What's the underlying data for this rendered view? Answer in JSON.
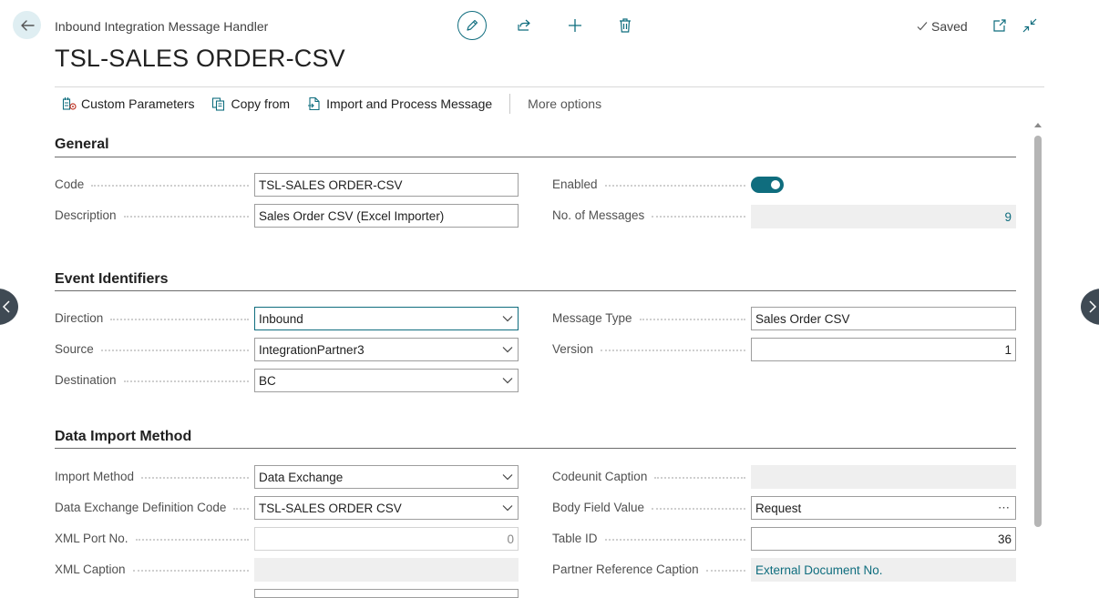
{
  "header": {
    "breadcrumb": "Inbound Integration Message Handler",
    "title": "TSL-SALES ORDER-CSV",
    "saved_label": "Saved"
  },
  "actions": {
    "custom_parameters": "Custom Parameters",
    "copy_from": "Copy from",
    "import_process": "Import and Process Message",
    "more_options": "More options"
  },
  "general": {
    "title": "General",
    "code_label": "Code",
    "code_value": "TSL-SALES ORDER-CSV",
    "description_label": "Description",
    "description_value": "Sales Order CSV (Excel Importer)",
    "enabled_label": "Enabled",
    "enabled_value": true,
    "messages_label": "No. of Messages",
    "messages_value": "9"
  },
  "event": {
    "title": "Event Identifiers",
    "direction_label": "Direction",
    "direction_value": "Inbound",
    "source_label": "Source",
    "source_value": "IntegrationPartner3",
    "destination_label": "Destination",
    "destination_value": "BC",
    "message_type_label": "Message Type",
    "message_type_value": "Sales Order CSV",
    "version_label": "Version",
    "version_value": "1"
  },
  "import": {
    "title": "Data Import Method",
    "method_label": "Import Method",
    "method_value": "Data Exchange",
    "dex_label": "Data Exchange Definition Code",
    "dex_value": "TSL-SALES ORDER CSV",
    "xmlport_label": "XML Port No.",
    "xmlport_value": "0",
    "xmlcaption_label": "XML Caption",
    "xmlcaption_value": "",
    "codeunit_label": "Codeunit Caption",
    "codeunit_value": "",
    "body_label": "Body Field Value",
    "body_value": "Request",
    "table_label": "Table ID",
    "table_value": "36",
    "partner_label": "Partner Reference Caption",
    "partner_value": "External Document No."
  },
  "colors": {
    "accent": "#0f6d7e",
    "nav_dark": "#3f4a54"
  }
}
